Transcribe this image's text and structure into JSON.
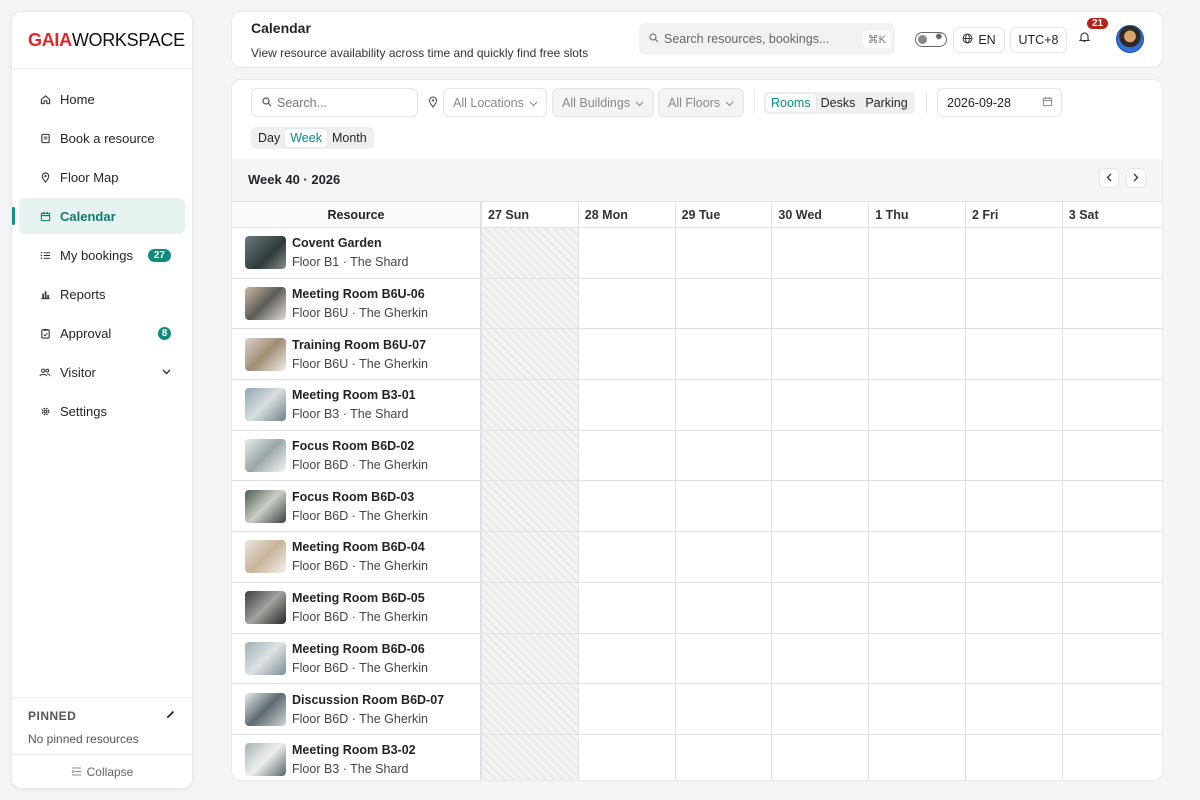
{
  "brand": {
    "part1": "GAIA",
    "part2": "WORKSPACE"
  },
  "sidebar": {
    "items": [
      {
        "label": "Home",
        "icon": "home-icon"
      },
      {
        "label": "Book a resource",
        "icon": "book-icon"
      },
      {
        "label": "Floor Map",
        "icon": "map-pin-icon"
      },
      {
        "label": "Calendar",
        "icon": "calendar-icon",
        "active": true
      },
      {
        "label": "My bookings",
        "icon": "list-icon",
        "badge": "27"
      },
      {
        "label": "Reports",
        "icon": "bar-chart-icon"
      },
      {
        "label": "Approval",
        "icon": "clipboard-icon",
        "badge": "8"
      },
      {
        "label": "Visitor",
        "icon": "users-icon"
      },
      {
        "label": "Settings",
        "icon": "gear-icon"
      }
    ],
    "pinned_title": "PINNED",
    "pinned_empty": "No pinned resources",
    "collapse_label": "Collapse"
  },
  "header": {
    "title": "Calendar",
    "subtitle": "View resource availability across time and quickly find free slots",
    "search_placeholder": "Search resources, bookings...",
    "search_shortcut": "⌘K",
    "language": "EN",
    "timezone": "UTC+8",
    "notifications": "21"
  },
  "filters": {
    "search_placeholder": "Search...",
    "location": "All Locations",
    "building": "All Buildings",
    "floor": "All Floors",
    "types": [
      "Rooms",
      "Desks",
      "Parking"
    ],
    "active_type": "Rooms",
    "date": "2026-09-28",
    "views": [
      "Day",
      "Week",
      "Month"
    ],
    "active_view": "Week"
  },
  "calendar": {
    "week_label": "Week 40 · 2026",
    "resource_header": "Resource",
    "days": [
      "27 Sun",
      "28 Mon",
      "29 Tue",
      "30 Wed",
      "1 Thu",
      "2 Fri",
      "3 Sat"
    ],
    "resources": [
      {
        "name": "Covent Garden",
        "location": "Floor B1 · The Shard"
      },
      {
        "name": "Meeting Room B6U-06",
        "location": "Floor B6U · The Gherkin"
      },
      {
        "name": "Training Room B6U-07",
        "location": "Floor B6U · The Gherkin"
      },
      {
        "name": "Meeting Room B3-01",
        "location": "Floor B3 · The Shard"
      },
      {
        "name": "Focus Room B6D-02",
        "location": "Floor B6D · The Gherkin"
      },
      {
        "name": "Focus Room B6D-03",
        "location": "Floor B6D · The Gherkin"
      },
      {
        "name": "Meeting Room B6D-04",
        "location": "Floor B6D · The Gherkin"
      },
      {
        "name": "Meeting Room B6D-05",
        "location": "Floor B6D · The Gherkin"
      },
      {
        "name": "Meeting Room B6D-06",
        "location": "Floor B6D · The Gherkin"
      },
      {
        "name": "Discussion Room B6D-07",
        "location": "Floor B6D · The Gherkin"
      },
      {
        "name": "Meeting Room B3-02",
        "location": "Floor B3 · The Shard"
      }
    ]
  },
  "colors": {
    "accent": "#0f8a7c",
    "brand_red": "#e0262d",
    "notif": "#b42318"
  }
}
